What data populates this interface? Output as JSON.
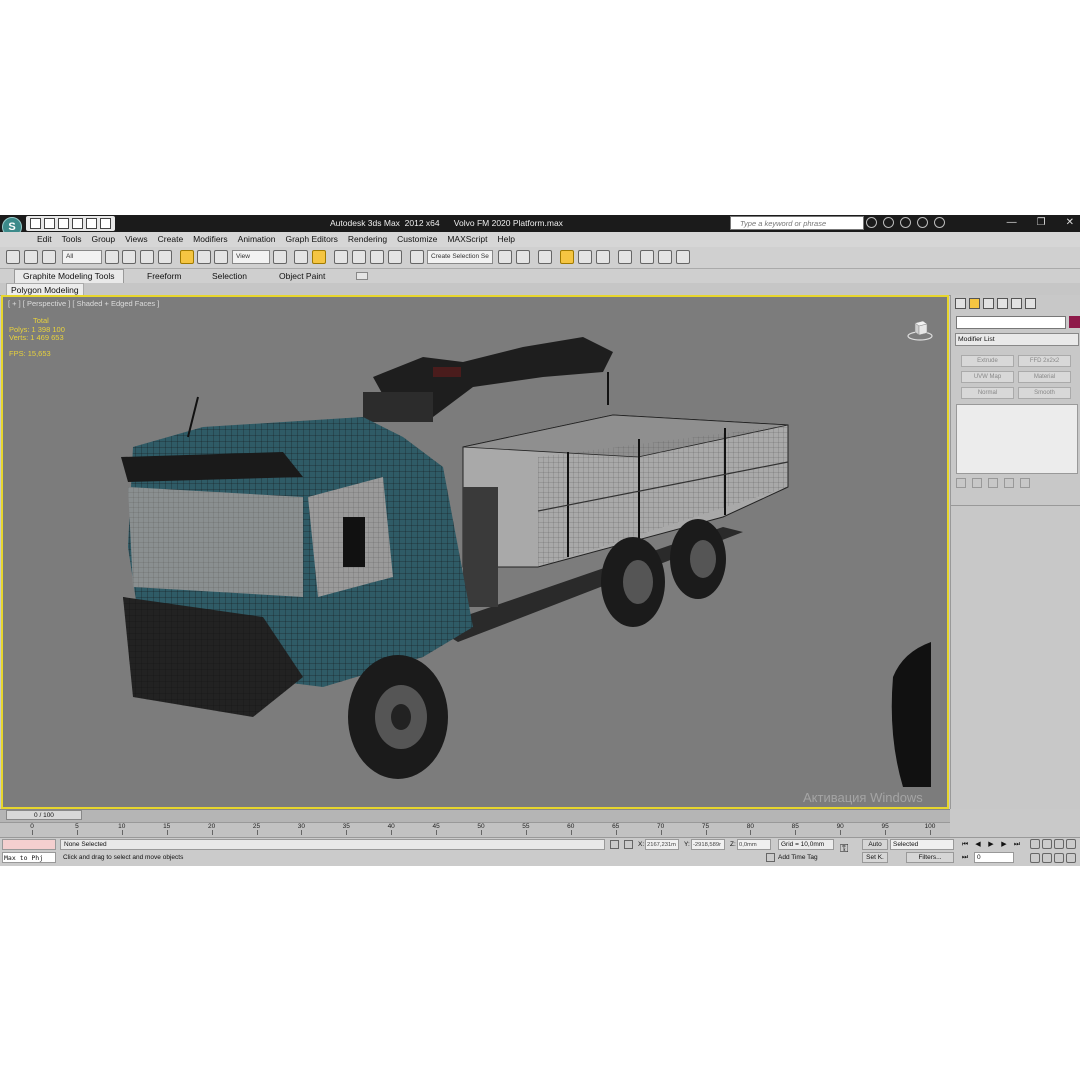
{
  "titlebar": {
    "logo": "S",
    "app_title": "Autodesk 3ds Max  2012 x64",
    "file_name": "Volvo FM 2020 Platform.max",
    "search_placeholder": "Type a keyword or phrase",
    "win_minimize": "—",
    "win_restore": "❐",
    "win_close": "✕"
  },
  "menu": [
    "Edit",
    "Tools",
    "Group",
    "Views",
    "Create",
    "Modifiers",
    "Animation",
    "Graph Editors",
    "Rendering",
    "Customize",
    "MAXScript",
    "Help"
  ],
  "toolbar": {
    "filter_dropdown": "All",
    "refcoord_dropdown": "View",
    "selection_set": "Create Selection Se"
  },
  "ribbon": {
    "tabs": [
      "Graphite Modeling Tools",
      "Freeform",
      "Selection",
      "Object Paint"
    ],
    "sub_tab": "Polygon Modeling"
  },
  "viewport": {
    "label": "[ + ] [ Perspective ] [ Shaded + Edged Faces ]",
    "stats_total": "Total",
    "polys": "Polys:  1 398 100",
    "verts": "Verts:  1 469 653",
    "fps": "FPS:    15,653",
    "watermark": "Активация Windows"
  },
  "command_panel": {
    "modifier_list": "Modifier List",
    "buttons": [
      "Extrude",
      "FFD 2x2x2",
      "UVW Map",
      "Material",
      "Normal",
      "Smooth"
    ]
  },
  "timeline": {
    "frame_counter": "0 / 100",
    "ticks": [
      0,
      5,
      10,
      15,
      20,
      25,
      30,
      35,
      40,
      45,
      50,
      55,
      60,
      65,
      70,
      75,
      80,
      85,
      90,
      95,
      100
    ]
  },
  "status": {
    "maxscript": "Max to Phj",
    "selection": "None Selected",
    "prompt": "Click and drag to select and move objects",
    "x_label": "X:",
    "x_value": "2167,231m",
    "y_label": "Y:",
    "y_value": "-2918,589r",
    "z_label": "Z:",
    "z_value": "0,0mm",
    "grid": "Grid = 10,0mm",
    "add_time_tag": "Add Time Tag",
    "auto": "Auto",
    "set_key": "Set K.",
    "selected_dropdown": "Selected",
    "filters": "Filters...",
    "frame": "0"
  },
  "colors": {
    "viewport_bg": "#7c7c7c",
    "viewport_border": "#e7d62d",
    "stats_text": "#e8d23c",
    "truck_cab": "#2f5b66"
  }
}
